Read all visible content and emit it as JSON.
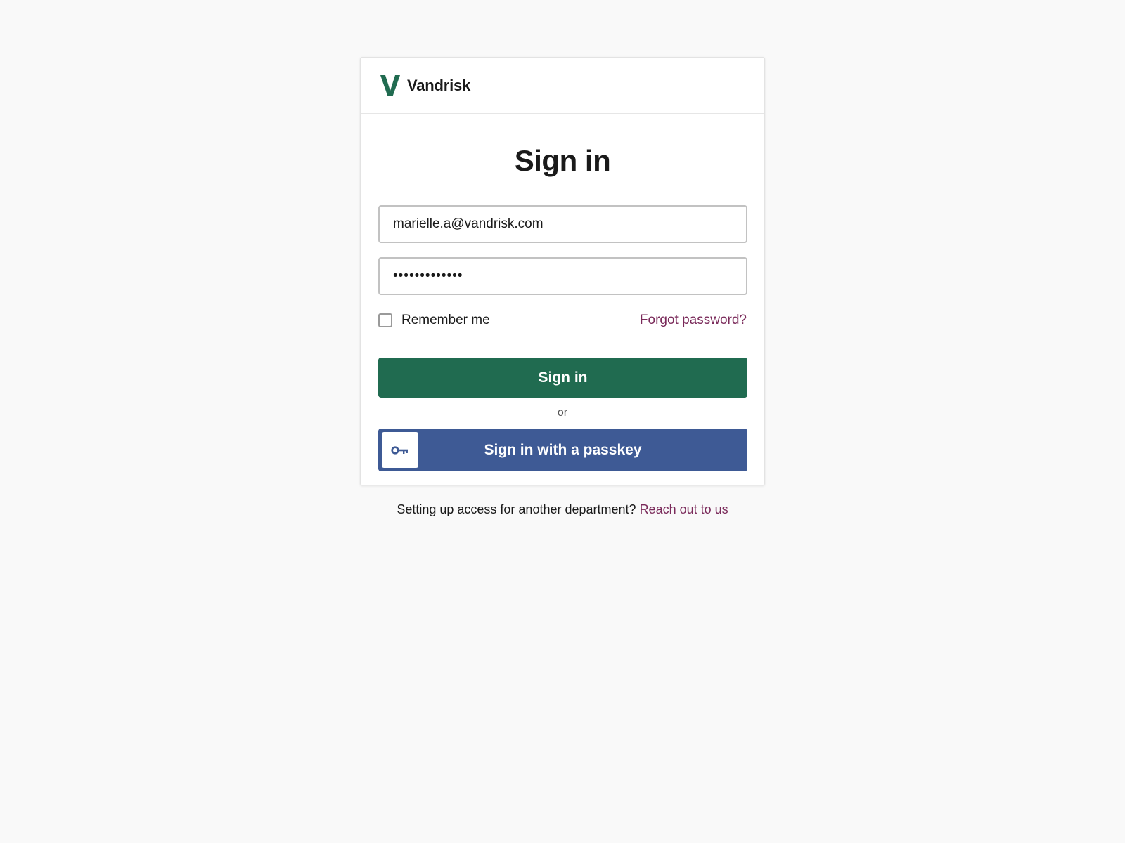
{
  "brand": {
    "name": "Vandrisk",
    "logo_icon": "v-logo-icon",
    "logo_color": "#206b50"
  },
  "form": {
    "title": "Sign in",
    "email_value": "marielle.a@vandrisk.com",
    "password_value": "•••••••••••••",
    "remember_label": "Remember me",
    "remember_checked": false,
    "forgot_label": "Forgot password?",
    "submit_label": "Sign in",
    "divider_label": "or",
    "passkey_label": "Sign in with a passkey",
    "passkey_icon": "key-icon"
  },
  "footer": {
    "text": "Setting up access for another department?",
    "link_label": "Reach out to us"
  },
  "colors": {
    "primary": "#206b50",
    "passkey": "#3e5a95",
    "link": "#7a2a5a",
    "background": "#f9f9f9"
  }
}
